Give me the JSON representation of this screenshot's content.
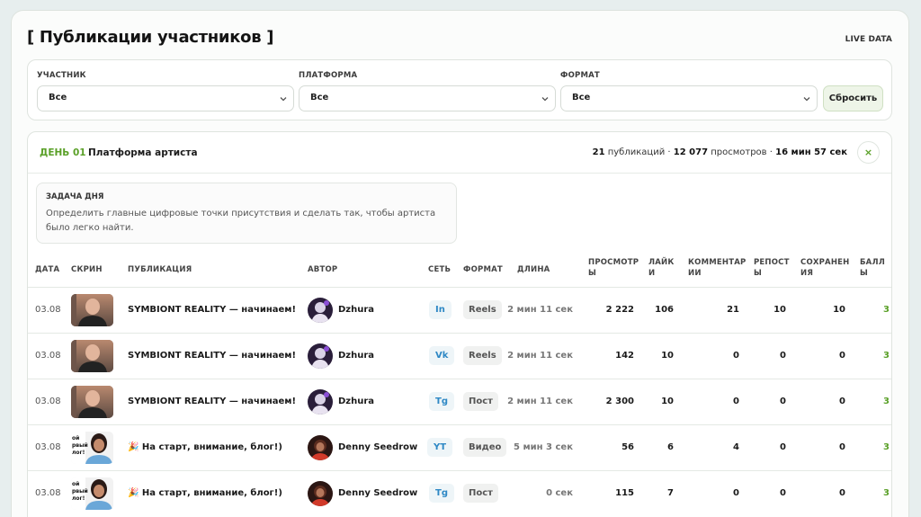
{
  "page": {
    "title": "[ Публикации участников ]",
    "live": "LIVE DATA"
  },
  "filters": {
    "participant": {
      "label": "УЧАСТНИК",
      "value": "Все"
    },
    "platform": {
      "label": "ПЛАТФОРМА",
      "value": "Все"
    },
    "format": {
      "label": "ФОРМАТ",
      "value": "Все"
    },
    "reset_label": "Сбросить"
  },
  "day": {
    "number": "ДЕНЬ 01",
    "name": "Платформа артиста",
    "publications_count": "21",
    "publications_label": "публикаций ·",
    "views_count": "12 077",
    "views_label": "просмотров ·",
    "duration": "16 мин 57 сек",
    "close_glyph": "×",
    "task_title": "ЗАДАЧА ДНЯ",
    "task_text": "Определить главные цифровые точки присутствия и сделать так, чтобы артиста было легко найти."
  },
  "table": {
    "headers": {
      "date": "ДАТА",
      "screen": "СКРИН",
      "publication": "ПУБЛИКАЦИЯ",
      "author": "АВТОР",
      "network": "СЕТЬ",
      "format": "ФОРМАТ",
      "length": "ДЛИНА",
      "views_1": "ПРОСМОТР",
      "views_2": "Ы",
      "likes_1": "ЛАЙК",
      "likes_2": "И",
      "comments_1": "КОММЕНТАР",
      "comments_2": "ИИ",
      "reposts_1": "РЕПОСТ",
      "reposts_2": "Ы",
      "saves_1": "СОХРАНЕН",
      "saves_2": "ИЯ",
      "points_1": "БАЛЛ",
      "points_2": "Ы"
    },
    "rows": [
      {
        "date": "03.08",
        "title": "SYMBIONT REALITY — начинаем!",
        "author": "Dzhura",
        "network": "In",
        "format": "Reels",
        "length": "2 мин 11 сек",
        "views": "2 222",
        "likes": "106",
        "comments": "21",
        "reposts": "10",
        "saves": "10",
        "points": "3"
      },
      {
        "date": "03.08",
        "title": "SYMBIONT REALITY — начинаем!",
        "author": "Dzhura",
        "network": "Vk",
        "format": "Reels",
        "length": "2 мин 11 сек",
        "views": "142",
        "likes": "10",
        "comments": "0",
        "reposts": "0",
        "saves": "0",
        "points": "3"
      },
      {
        "date": "03.08",
        "title": "SYMBIONT REALITY — начинаем!",
        "author": "Dzhura",
        "network": "Tg",
        "format": "Пост",
        "length": "2 мин 11 сек",
        "views": "2 300",
        "likes": "10",
        "comments": "0",
        "reposts": "0",
        "saves": "0",
        "points": "3"
      },
      {
        "date": "03.08",
        "title": "🎉 На старт, внимание, блог!)",
        "author": "Denny Seedrow",
        "network": "YT",
        "format": "Видео",
        "length": "5 мин 3 сек",
        "views": "56",
        "likes": "6",
        "comments": "4",
        "reposts": "0",
        "saves": "0",
        "points": "3"
      },
      {
        "date": "03.08",
        "title": "🎉 На старт, внимание, блог!)",
        "author": "Denny Seedrow",
        "network": "Tg",
        "format": "Пост",
        "length": "0 сек",
        "views": "115",
        "likes": "7",
        "comments": "0",
        "reposts": "0",
        "saves": "0",
        "points": "3"
      }
    ]
  },
  "colors": {
    "accent": "#5aa028",
    "network": "#2e88c5"
  }
}
